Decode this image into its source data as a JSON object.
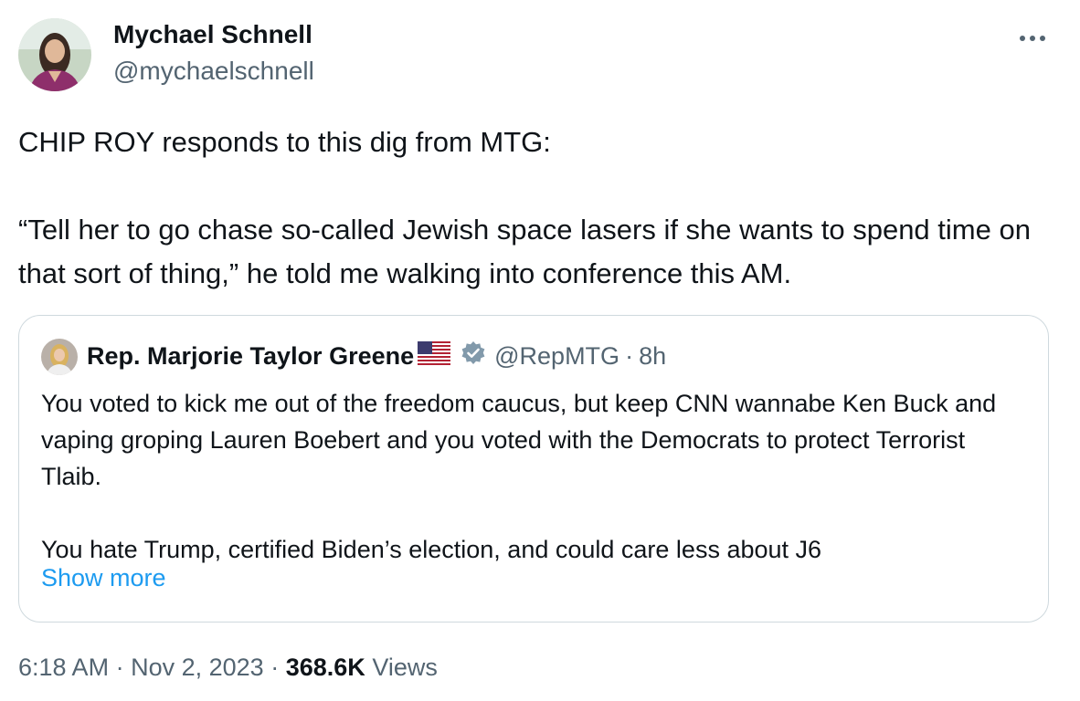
{
  "tweet": {
    "author_name": "Mychael Schnell",
    "author_handle": "@mychaelschnell",
    "avatar_icon": "profile-photo-icon",
    "more_icon": "more-options-icon",
    "text": "CHIP ROY responds to this dig from MTG:\n\n“Tell her to go chase so-called Jewish space lasers if she wants to spend time on that sort of thing,” he told me walking into conference this AM.",
    "time": "6:18 AM",
    "separator": "·",
    "date": "Nov 2, 2023",
    "views_count": "368.6K",
    "views_label": "Views"
  },
  "quote": {
    "author_name": "Rep. Marjorie Taylor Greene",
    "flag_icon": "us-flag-icon",
    "verified_icon": "verified-badge-icon",
    "handle": "@RepMTG",
    "separator": "·",
    "time_ago": "8h",
    "text": "You voted to kick me out of the freedom caucus, but keep CNN wannabe Ken Buck and vaping groping Lauren Boebert and you voted with the Democrats to protect Terrorist Tlaib.\n\nYou hate Trump, certified Biden’s election, and could care less about J6",
    "show_more": "Show more"
  },
  "colors": {
    "text_primary": "#0f1419",
    "text_secondary": "#536471",
    "link": "#1d9bf0",
    "border": "#cfd9de",
    "verified_badge": "#829aab"
  }
}
